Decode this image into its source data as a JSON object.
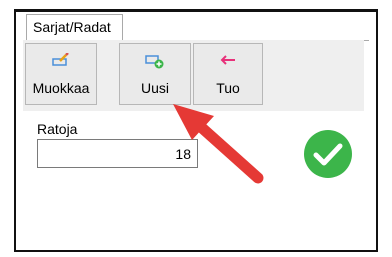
{
  "tab": {
    "label": "Sarjat/Radat"
  },
  "toolbar": {
    "edit_label": "Muokkaa",
    "new_label": "Uusi",
    "import_label": "Tuo"
  },
  "field": {
    "label": "Ratoja",
    "value": "18"
  },
  "status": {
    "icon": "check-circle-icon",
    "color": "#3cb54a"
  },
  "annotation": {
    "arrow_color": "#e53935"
  }
}
